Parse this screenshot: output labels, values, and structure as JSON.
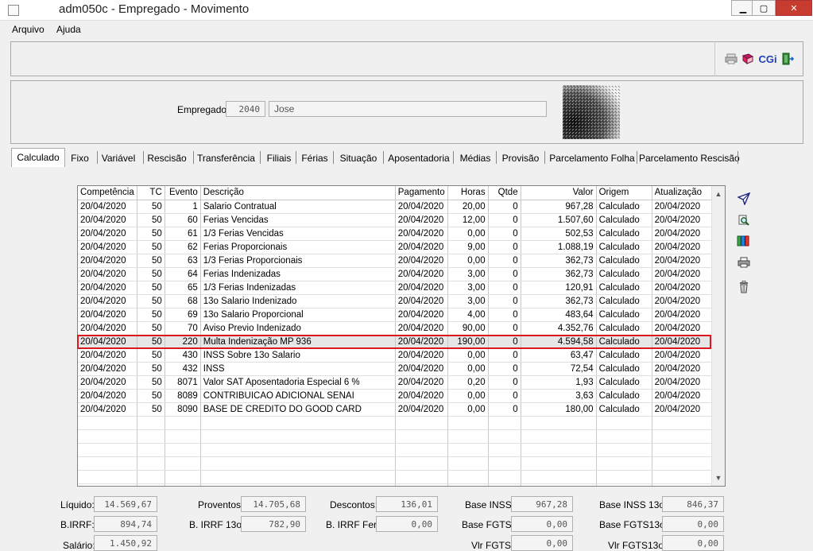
{
  "window": {
    "title": "adm050c - Empregado - Movimento"
  },
  "menu": {
    "items": [
      "Arquivo",
      "Ajuda"
    ]
  },
  "employee": {
    "label": "Empregado:",
    "code": "2040",
    "name": "Jose"
  },
  "tabs": [
    "Calculado",
    "Fixo",
    "Variável",
    "Rescisão",
    "Transferência",
    "Filiais",
    "Férias",
    "Situação",
    "Aposentadoria",
    "Médias",
    "Provisão",
    "Parcelamento Folha",
    "Parcelamento Rescisão"
  ],
  "active_tab": "Calculado",
  "grid": {
    "columns": [
      "Competência",
      "TC",
      "Evento",
      "Descrição",
      "Pagamento",
      "Horas",
      "Qtde",
      "Valor",
      "Origem",
      "Atualização"
    ],
    "rows": [
      [
        "20/04/2020",
        "50",
        "1",
        "Salario Contratual",
        "20/04/2020",
        "20,00",
        "0",
        "967,28",
        "Calculado",
        "20/04/2020"
      ],
      [
        "20/04/2020",
        "50",
        "60",
        "Ferias Vencidas",
        "20/04/2020",
        "12,00",
        "0",
        "1.507,60",
        "Calculado",
        "20/04/2020"
      ],
      [
        "20/04/2020",
        "50",
        "61",
        "1/3 Ferias Vencidas",
        "20/04/2020",
        "0,00",
        "0",
        "502,53",
        "Calculado",
        "20/04/2020"
      ],
      [
        "20/04/2020",
        "50",
        "62",
        "Ferias Proporcionais",
        "20/04/2020",
        "9,00",
        "0",
        "1.088,19",
        "Calculado",
        "20/04/2020"
      ],
      [
        "20/04/2020",
        "50",
        "63",
        "1/3 Ferias Proporcionais",
        "20/04/2020",
        "0,00",
        "0",
        "362,73",
        "Calculado",
        "20/04/2020"
      ],
      [
        "20/04/2020",
        "50",
        "64",
        "Ferias Indenizadas",
        "20/04/2020",
        "3,00",
        "0",
        "362,73",
        "Calculado",
        "20/04/2020"
      ],
      [
        "20/04/2020",
        "50",
        "65",
        "1/3 Ferias Indenizadas",
        "20/04/2020",
        "3,00",
        "0",
        "120,91",
        "Calculado",
        "20/04/2020"
      ],
      [
        "20/04/2020",
        "50",
        "68",
        "13o Salario Indenizado",
        "20/04/2020",
        "3,00",
        "0",
        "362,73",
        "Calculado",
        "20/04/2020"
      ],
      [
        "20/04/2020",
        "50",
        "69",
        "13o Salario Proporcional",
        "20/04/2020",
        "4,00",
        "0",
        "483,64",
        "Calculado",
        "20/04/2020"
      ],
      [
        "20/04/2020",
        "50",
        "70",
        "Aviso Previo Indenizado",
        "20/04/2020",
        "90,00",
        "0",
        "4.352,76",
        "Calculado",
        "20/04/2020"
      ],
      [
        "20/04/2020",
        "50",
        "220",
        "Multa Indenização MP 936",
        "20/04/2020",
        "190,00",
        "0",
        "4.594,58",
        "Calculado",
        "20/04/2020"
      ],
      [
        "20/04/2020",
        "50",
        "430",
        "INSS Sobre 13o Salario",
        "20/04/2020",
        "0,00",
        "0",
        "63,47",
        "Calculado",
        "20/04/2020"
      ],
      [
        "20/04/2020",
        "50",
        "432",
        "INSS",
        "20/04/2020",
        "0,00",
        "0",
        "72,54",
        "Calculado",
        "20/04/2020"
      ],
      [
        "20/04/2020",
        "50",
        "8071",
        "Valor SAT Aposentadoria Especial 6 %",
        "20/04/2020",
        "0,20",
        "0",
        "1,93",
        "Calculado",
        "20/04/2020"
      ],
      [
        "20/04/2020",
        "50",
        "8089",
        "CONTRIBUICAO ADICIONAL SENAI",
        "20/04/2020",
        "0,00",
        "0",
        "3,63",
        "Calculado",
        "20/04/2020"
      ],
      [
        "20/04/2020",
        "50",
        "8090",
        "BASE DE CREDITO DO GOOD CARD",
        "20/04/2020",
        "0,00",
        "0",
        "180,00",
        "Calculado",
        "20/04/2020"
      ]
    ],
    "empty_rows": 6,
    "selected_row": 10
  },
  "totals": {
    "liquido": {
      "label": "Líquido:",
      "value": "14.569,67"
    },
    "proventos": {
      "label": "Proventos:",
      "value": "14.705,68"
    },
    "descontos": {
      "label": "Descontos:",
      "value": "136,01"
    },
    "base_inss": {
      "label": "Base INSS:",
      "value": "967,28"
    },
    "base_inss_13o": {
      "label": "Base INSS 13o:",
      "value": "846,37"
    },
    "birrf": {
      "label": "B.IRRF:",
      "value": "894,74"
    },
    "birrf_13o": {
      "label": "B. IRRF 13o:",
      "value": "782,90"
    },
    "birrf_fer": {
      "label": "B. IRRF Fer:",
      "value": "0,00"
    },
    "base_fgts": {
      "label": "Base FGTS:",
      "value": "0,00"
    },
    "base_fgts_13o": {
      "label": "Base FGTS13o:",
      "value": "0,00"
    },
    "salario": {
      "label": "Salário:",
      "value": "1.450,92"
    },
    "vlr_fgts": {
      "label": "Vlr FGTS:",
      "value": "0,00"
    },
    "vlr_fgts_13o": {
      "label": "Vlr FGTS13o:",
      "value": "0,00"
    }
  },
  "toolbar": {
    "cgi_label": "CGi"
  },
  "colors": {
    "selection_border": "#d9191f",
    "close_button": "#c73c2e",
    "cgi_text": "#1f3fbf"
  },
  "icons": [
    "printer-icon",
    "book-icon",
    "cgi-logo",
    "exit-door-icon",
    "send-arrow-icon",
    "search-doc-icon",
    "columns-icon",
    "print-icon",
    "trash-icon"
  ]
}
